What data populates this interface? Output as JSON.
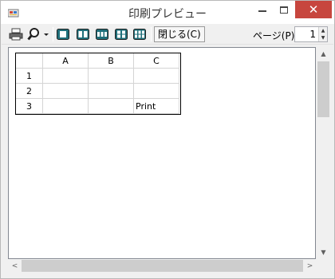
{
  "window": {
    "title": "印刷プレビュー",
    "close_glyph": "✕"
  },
  "toolbar": {
    "close_label": "閉じる(C)",
    "page_label": "ページ(P)",
    "page_value": "1",
    "icons": [
      "printer-icon",
      "zoom-icon",
      "one-page-icon",
      "two-pages-icon",
      "three-pages-icon",
      "four-pages-icon",
      "six-pages-icon"
    ]
  },
  "sheet": {
    "columns": [
      "A",
      "B",
      "C"
    ],
    "rows": [
      {
        "header": "1",
        "cells": [
          "",
          "",
          ""
        ]
      },
      {
        "header": "2",
        "cells": [
          "",
          "",
          ""
        ]
      },
      {
        "header": "3",
        "cells": [
          "",
          "",
          "Print"
        ]
      }
    ]
  },
  "colors": {
    "close_button": "#c7463e",
    "page_icon": "#1f6f7a"
  }
}
